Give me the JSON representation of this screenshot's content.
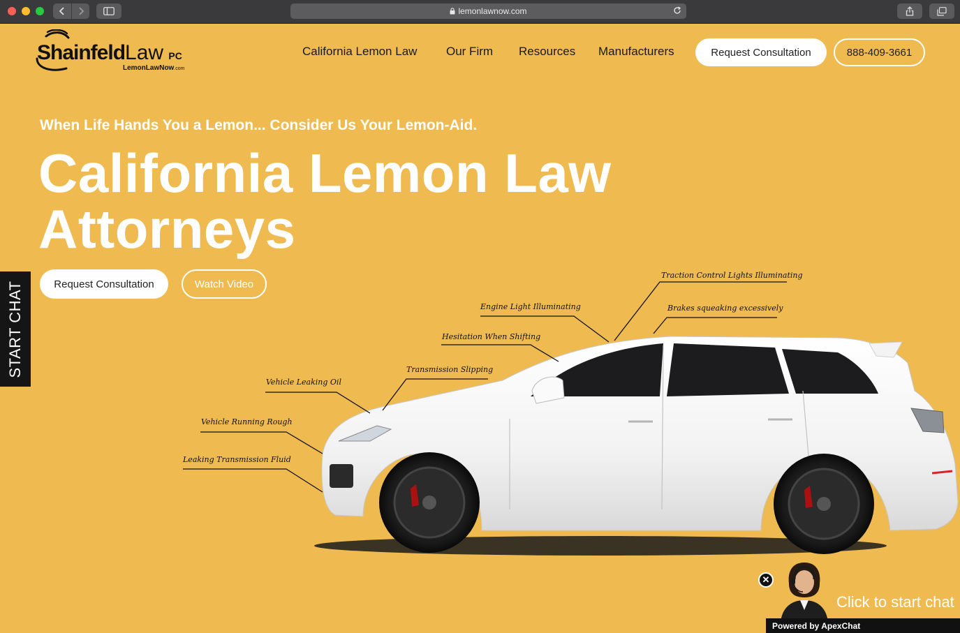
{
  "browser": {
    "url": "lemonlawnow.com"
  },
  "logo": {
    "name": "Shainfeld",
    "law": "Law",
    "pc": "PC",
    "sub_bold": "LemonLawNow",
    "sub_small": ".com"
  },
  "nav": {
    "items": [
      "California Lemon Law",
      "Our Firm",
      "Resources",
      "Manufacturers"
    ],
    "cta_label": "Request Consultation",
    "phone": "888-409-3661"
  },
  "hero": {
    "tagline": "When Life Hands You a Lemon... Consider Us Your Lemon-Aid.",
    "title_line1": "California Lemon Law",
    "title_line2": "Attorneys",
    "primary_button": "Request Consultation",
    "secondary_button": "Watch Video"
  },
  "sidebar_chat": {
    "label": "START CHAT"
  },
  "callouts": [
    "Traction Control Lights Illuminating",
    "Engine Light Illuminating",
    "Brakes squeaking excessively",
    "Hesitation When Shifting",
    "Transmission Slipping",
    "Vehicle Leaking Oil",
    "Vehicle Running Rough",
    "Leaking Transmission Fluid"
  ],
  "chat_widget": {
    "cta": "Click to start chat",
    "powered_by": "Powered by ApexChat"
  },
  "colors": {
    "background": "#efbb50",
    "text_dark": "#1a1a1a",
    "white": "#ffffff"
  }
}
